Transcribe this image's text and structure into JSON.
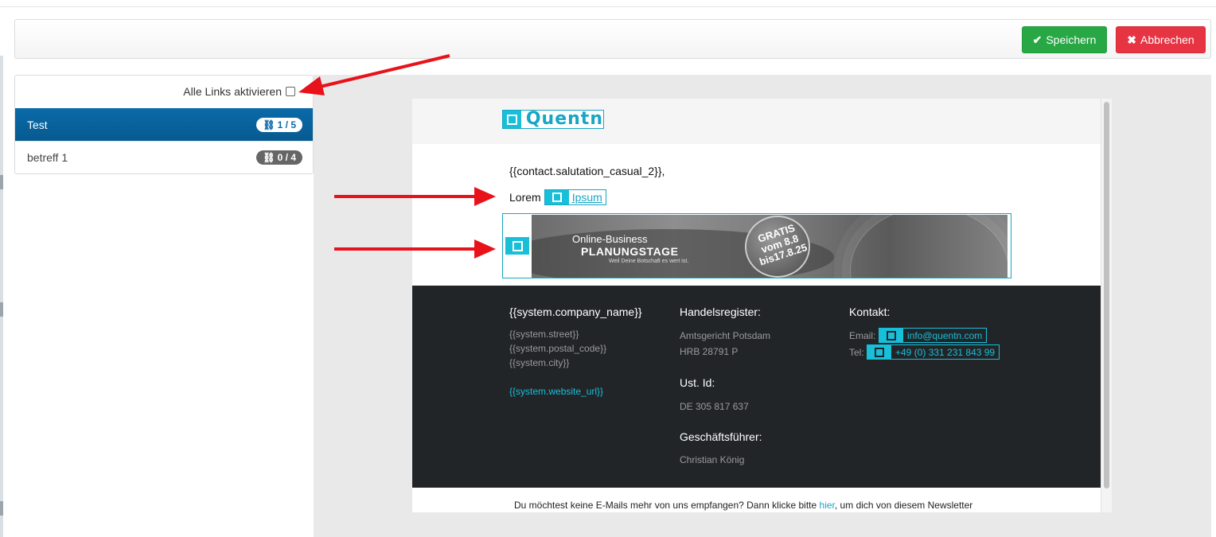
{
  "toolbar": {
    "save_label": "Speichern",
    "cancel_label": "Abbrechen"
  },
  "left_panel": {
    "activate_all_label": "Alle Links aktivieren",
    "items": [
      {
        "label": "Test",
        "badge": "1 / 5",
        "active": true
      },
      {
        "label": "betreff 1",
        "badge": "0 / 4",
        "active": false
      }
    ]
  },
  "email": {
    "logo_text": "Quentn",
    "salutation": "{{contact.salutation_casual_2}},",
    "lorem_prefix": "Lorem",
    "lorem_link": "Ipsum",
    "banner": {
      "line1": "Online-Business",
      "line2": "PLANUNGSTAGE",
      "line3": "Weil Deine Botschaft es wert ist.",
      "badge_line1": "GRATIS",
      "badge_line2": "vom 8.8",
      "badge_line3": "bis17.8.25"
    },
    "footer": {
      "col1": {
        "heading": "{{system.company_name}}",
        "street": "{{system.street}}",
        "postal": "{{system.postal_code}}",
        "city": "{{system.city}}",
        "website": "{{system.website_url}}"
      },
      "col2": {
        "heading1": "Handelsregister:",
        "court": "Amtsgericht Potsdam",
        "hrb": "HRB 28791 P",
        "heading2": "Ust. Id:",
        "vat": "DE 305 817 637",
        "heading3": "Geschäftsführer:",
        "ceo": "Christian König"
      },
      "col3": {
        "heading": "Kontakt:",
        "email_label": "Email:",
        "email_value": "info@quentn.com",
        "tel_label": "Tel:",
        "tel_value": "+49 (0) 331 231 843 99"
      }
    },
    "unsubscribe": {
      "before": "Du möchtest keine E-Mails mehr von uns empfangen? Dann klicke bitte ",
      "link": "hier",
      "after": ", um dich von diesem Newsletter"
    }
  },
  "colors": {
    "save": "#28a745",
    "cancel": "#e63442",
    "active_item": "#0a6aa8",
    "link_tag": "#17bfd9",
    "footer_bg": "#222528",
    "annotation_arrow": "#e8121b"
  },
  "icons": [
    "check-icon",
    "times-icon",
    "link-icon",
    "checkbox-icon",
    "arrow-annotation"
  ]
}
